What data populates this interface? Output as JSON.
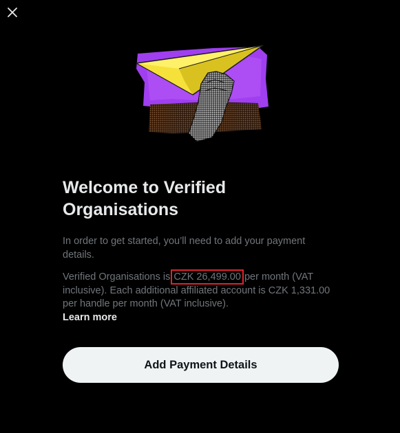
{
  "icons": {
    "close": "close-icon",
    "hero": "paper-plane-hand-illustration"
  },
  "colors": {
    "background": "#000000",
    "title_text": "#e7e9ea",
    "body_text": "#71767b",
    "button_bg": "#eff3f4",
    "button_text": "#0f1419",
    "highlight_box": "#e0242a"
  },
  "dialog": {
    "title_line1": "Welcome to Verified",
    "title_line2": "Organisations",
    "intro": "In order to get started, you’ll need to add your payment details.",
    "pricing": {
      "prefix": "Verified Organisations is ",
      "price": "CZK 26,499.00",
      "suffix": " per month (VAT inclusive). Each additional affiliated account is CZK 1,331.00 per handle per month (VAT inclusive)."
    },
    "learn_more": "Learn more",
    "cta_label": "Add Payment Details"
  }
}
